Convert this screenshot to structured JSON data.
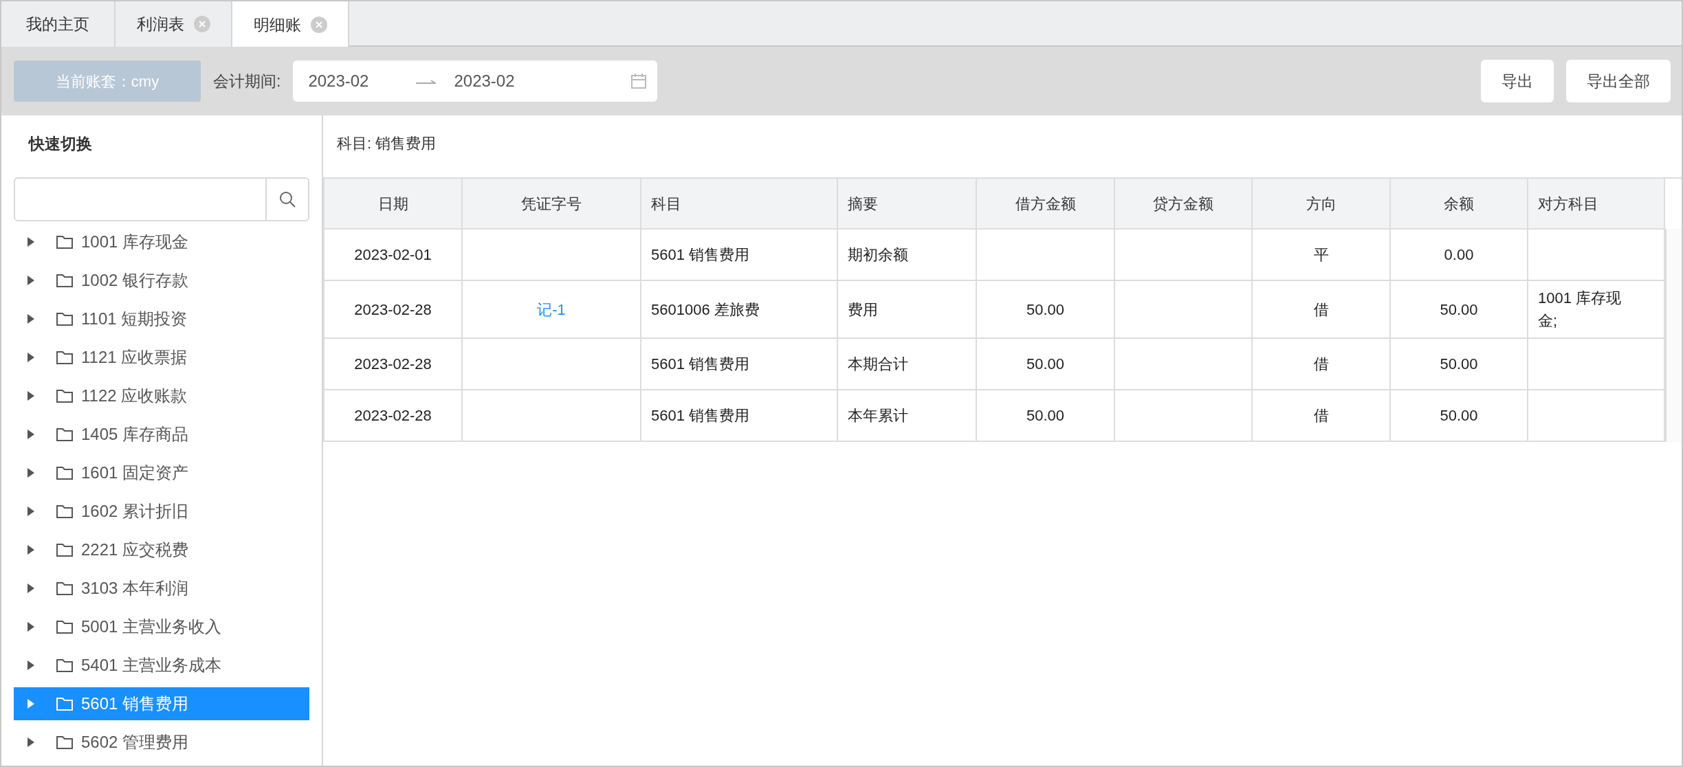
{
  "tabs": [
    {
      "label": "我的主页",
      "selected": false,
      "closable": false
    },
    {
      "label": "利润表",
      "selected": false,
      "closable": true
    },
    {
      "label": "明细账",
      "selected": true,
      "closable": true
    }
  ],
  "toolbar": {
    "account": "当前账套：cmy",
    "period_label": "会计期间:",
    "period_start": "2023-02",
    "period_end": "2023-02",
    "buttons": [
      "导出",
      "导出全部"
    ]
  },
  "sidebar": {
    "title": "快速切换",
    "items": [
      {
        "label": "1001 库存现金",
        "expanded": false,
        "selected": false
      },
      {
        "label": "1002 银行存款",
        "expanded": false,
        "selected": false
      },
      {
        "label": "1101 短期投资",
        "expanded": false,
        "selected": false
      },
      {
        "label": "1121 应收票据",
        "expanded": false,
        "selected": false
      },
      {
        "label": "1122 应收账款",
        "expanded": false,
        "selected": false
      },
      {
        "label": "1405 库存商品",
        "expanded": false,
        "selected": false
      },
      {
        "label": "1601 固定资产",
        "expanded": false,
        "selected": false
      },
      {
        "label": "1602 累计折旧",
        "expanded": false,
        "selected": false
      },
      {
        "label": "2221 应交税费",
        "expanded": false,
        "selected": false
      },
      {
        "label": "3103 本年利润",
        "expanded": false,
        "selected": false
      },
      {
        "label": "5001 主营业务收入",
        "expanded": false,
        "selected": false
      },
      {
        "label": "5401 主营业务成本",
        "expanded": false,
        "selected": false
      },
      {
        "label": "5601 销售费用",
        "expanded": false,
        "selected": true
      },
      {
        "label": "5602 管理费用",
        "expanded": false,
        "selected": false
      }
    ]
  },
  "subject": "科目: 销售费用",
  "table": {
    "columns": [
      "日期",
      "凭证字号",
      "科目",
      "摘要",
      "借方金额",
      "贷方金额",
      "方向",
      "余额",
      "对方科目"
    ],
    "rows": [
      {
        "cells": [
          "2023-02-01",
          "",
          "5601 销售费用",
          "期初余额",
          "",
          "",
          "平",
          "0.00",
          ""
        ]
      },
      {
        "voucher_link": true,
        "cells": [
          "2023-02-28",
          "记-1",
          "5601006 差旅费",
          "费用",
          "50.00",
          "",
          "借",
          "50.00",
          "1001 库存现金;"
        ]
      },
      {
        "cells": [
          "2023-02-28",
          "",
          "5601 销售费用",
          "本期合计",
          "50.00",
          "",
          "借",
          "50.00",
          ""
        ]
      },
      {
        "cells": [
          "2023-02-28",
          "",
          "5601 销售费用",
          "本年累计",
          "50.00",
          "",
          "借",
          "50.00",
          ""
        ]
      }
    ]
  }
}
